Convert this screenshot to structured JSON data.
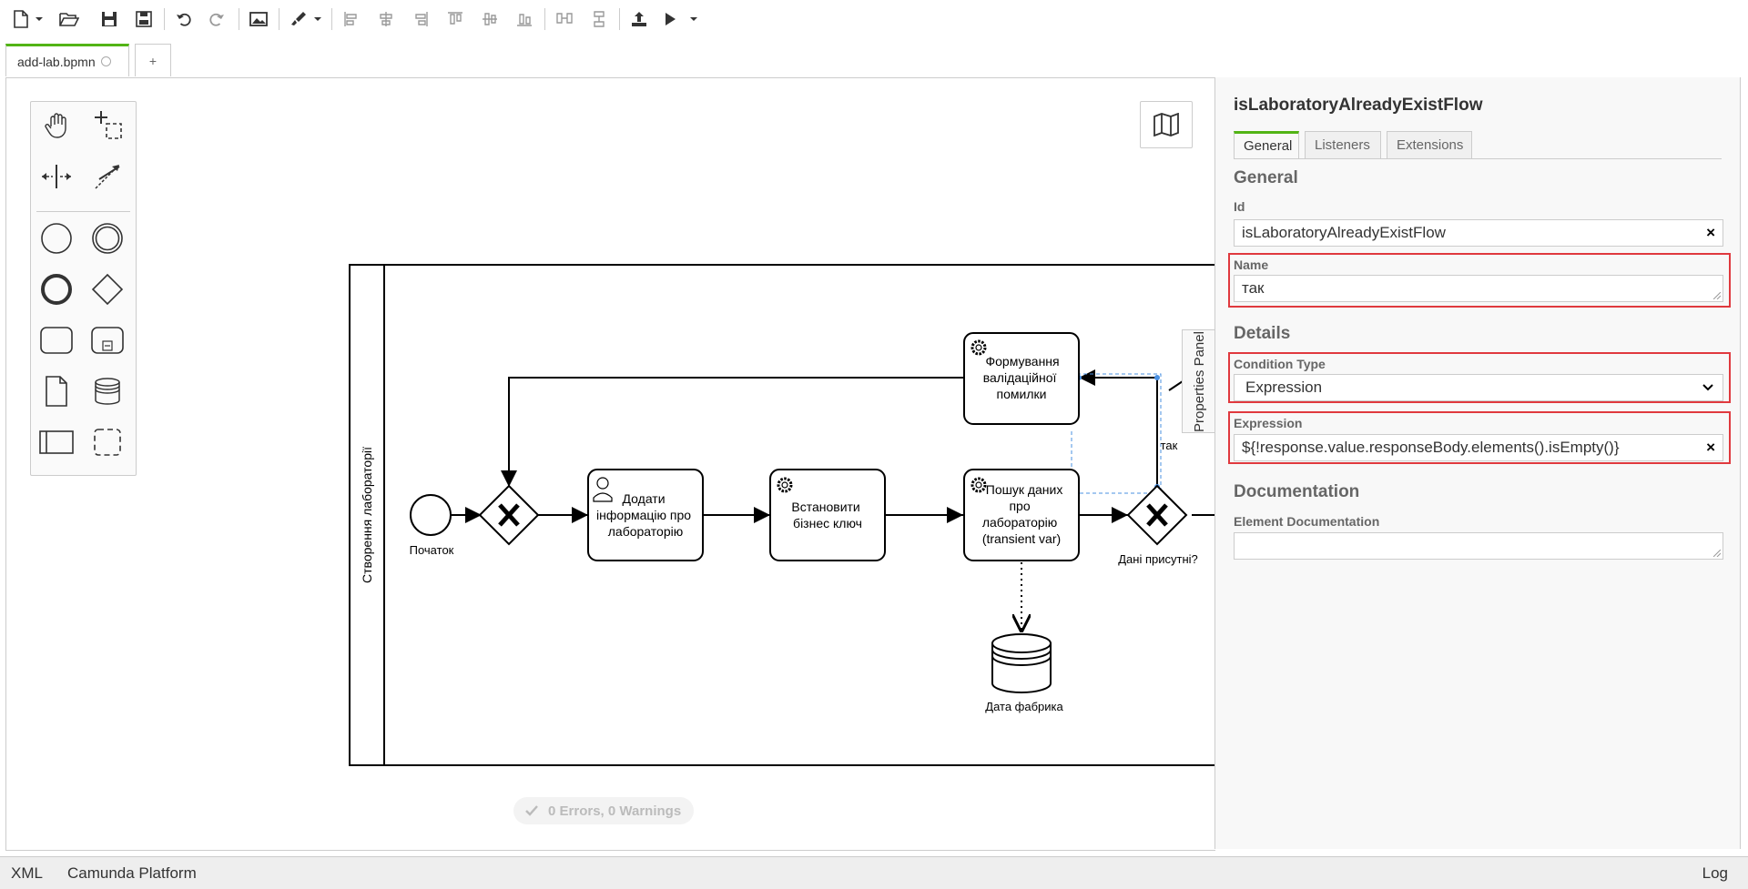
{
  "tabs": {
    "file": "add-lab.bpmn",
    "add": "+"
  },
  "diagram": {
    "lane_label": "Створення лабораторії",
    "start_label": "Початок",
    "task_add_info": [
      "Додати",
      "інформацію про",
      "лабораторію"
    ],
    "task_business_key": [
      "Встановити",
      "бізнес ключ"
    ],
    "task_search": [
      "Пошук даних",
      "про",
      "лабораторію",
      "(transient var)"
    ],
    "task_error": [
      "Формування",
      "валідаційної",
      "помилки"
    ],
    "gateway_label": "Дані присутні?",
    "flow_label": "так",
    "datastore_label": "Дата фабрика"
  },
  "status": {
    "errors": "0 Errors, 0 Warnings"
  },
  "properties_toggle": "Properties Panel",
  "properties": {
    "element_title": "isLaboratoryAlreadyExistFlow",
    "tabs": [
      "General",
      "Listeners",
      "Extensions"
    ],
    "general_group": "General",
    "id_label": "Id",
    "id_value": "isLaboratoryAlreadyExistFlow",
    "name_label": "Name",
    "name_value": "так",
    "details_group": "Details",
    "condition_type_label": "Condition Type",
    "condition_type_value": "Expression",
    "expression_label": "Expression",
    "expression_value": "${!response.value.responseBody.elements().isEmpty()}",
    "documentation_group": "Documentation",
    "element_doc_label": "Element Documentation",
    "element_doc_value": ""
  },
  "statusbar": {
    "xml": "XML",
    "platform": "Camunda Platform",
    "log": "Log"
  },
  "colors": {
    "accent": "#52b415",
    "highlight": "#e0393e",
    "selection": "#4a90e2"
  }
}
